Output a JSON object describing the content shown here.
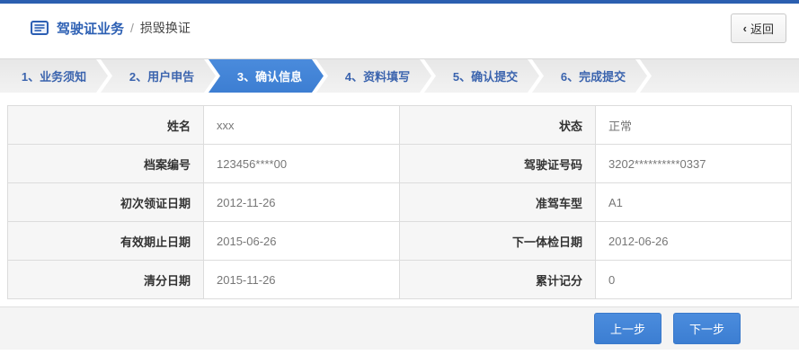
{
  "header": {
    "title": "驾驶证业务",
    "breadcrumb_separator": "/",
    "subtitle": "损毁换证",
    "back_chevron": "‹",
    "back_label": "返回"
  },
  "steps": {
    "active_step": 3,
    "items": [
      "1、业务须知",
      "2、用户申告",
      "3、确认信息",
      "4、资料填写",
      "5、确认提交",
      "6、完成提交"
    ]
  },
  "table": {
    "rows": [
      [
        {
          "label": "姓名",
          "value": "xxx"
        },
        {
          "label": "状态",
          "value": "正常"
        }
      ],
      [
        {
          "label": "档案编号",
          "value": "123456****00"
        },
        {
          "label": "驾驶证号码",
          "value": "3202**********0337"
        }
      ],
      [
        {
          "label": "初次领证日期",
          "value": "2012-11-26"
        },
        {
          "label": "准驾车型",
          "value": "A1"
        }
      ],
      [
        {
          "label": "有效期止日期",
          "value": "2015-06-26"
        },
        {
          "label": "下一体检日期",
          "value": "2012-06-26"
        }
      ],
      [
        {
          "label": "清分日期",
          "value": "2015-11-26"
        },
        {
          "label": "累计记分",
          "value": "0"
        }
      ]
    ]
  },
  "footer": {
    "prev_label": "上一步",
    "next_label": "下一步"
  },
  "colors": {
    "accent_blue": "#2b5fb0",
    "title_blue": "#2c5fb3",
    "active_step_blue": "#4285d8",
    "step_text_blue": "#3b64ae",
    "label_cell_bg": "#f6f6f6",
    "border_gray": "#dcdcdc",
    "footer_bg": "#f4f4f4"
  }
}
